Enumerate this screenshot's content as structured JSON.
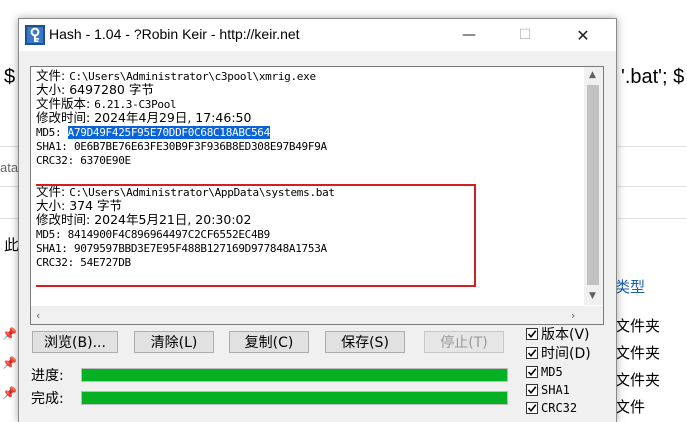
{
  "background": {
    "left_dollar": "$",
    "right_fragment": "'.bat'; $",
    "left_ata": "ata",
    "left_ci": "此",
    "right_items": [
      "类型",
      "文件夹",
      "文件夹",
      "文件夹",
      "文件"
    ]
  },
  "window": {
    "title": "Hash - 1.04 - ?Robin Keir - http://keir.net",
    "controls": {
      "minimize": "—",
      "maximize": "☐",
      "close": "✕"
    }
  },
  "results": [
    {
      "file_label": "文件: ",
      "file": "C:\\Users\\Administrator\\c3pool\\xmrig.exe",
      "size_label": "大小: ",
      "size": "6497280 字节",
      "version_label": "文件版本: ",
      "version": "6.21.3-C3Pool",
      "mtime_label": "修改时间: ",
      "mtime": "2024年4月29日, 17:46:50",
      "md5_label": "MD5: ",
      "md5": "A79D49F425F95E70DDF0C68C18ABC564",
      "sha1_label": "SHA1: ",
      "sha1": "0E6B7BE76E63FE30B9F3F936B8ED308E97B49F9A",
      "crc32_label": "CRC32: ",
      "crc32": "6370E90E"
    },
    {
      "file_label": "文件: ",
      "file": "C:\\Users\\Administrator\\AppData\\systems.bat",
      "size_label": "大小: ",
      "size": "374 字节",
      "mtime_label": "修改时间: ",
      "mtime": "2024年5月21日, 20:30:02",
      "md5_label": "MD5: ",
      "md5": "8414900F4C896964497C2CF6552EC4B9",
      "sha1_label": "SHA1: ",
      "sha1": "9079597BBD3E7E95F488B127169D977848A1753A",
      "crc32_label": "CRC32: ",
      "crc32": "54E727DB"
    }
  ],
  "buttons": {
    "browse": "浏览(B)...",
    "clear": "清除(L)",
    "copy": "复制(C)",
    "save": "保存(S)",
    "stop": "停止(T)"
  },
  "progress": {
    "progress_label": "进度:",
    "complete_label": "完成:",
    "progress_value": 1.0,
    "complete_value": 1.0,
    "color": "#06b025"
  },
  "options": [
    {
      "label": "版本(V)",
      "checked": true
    },
    {
      "label": "时间(D)",
      "checked": true
    },
    {
      "label": "MD5",
      "checked": true
    },
    {
      "label": "SHA1",
      "checked": true
    },
    {
      "label": "CRC32",
      "checked": true
    }
  ],
  "colors": {
    "selection": "#0a64d8",
    "highlight_box": "#d41f1f"
  }
}
